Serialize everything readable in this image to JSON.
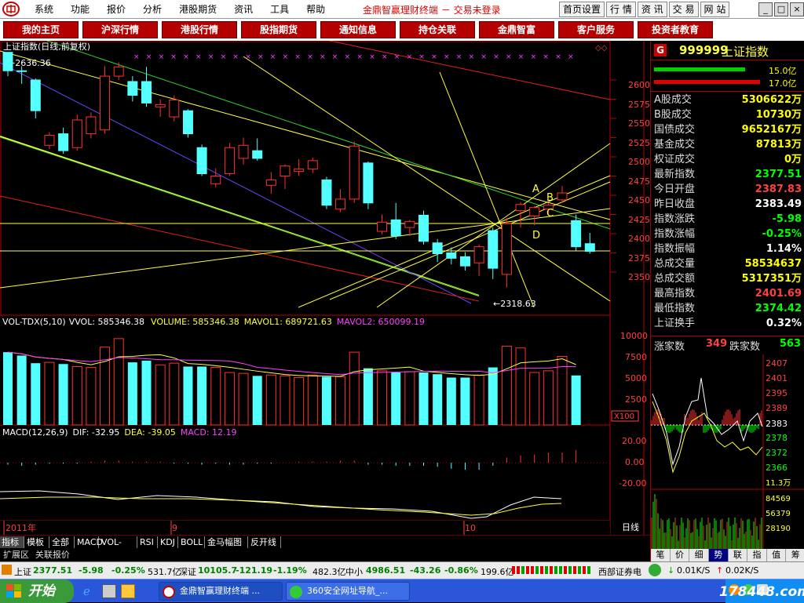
{
  "menubar": {
    "items": [
      "系统",
      "功能",
      "报价",
      "分析",
      "港股期货",
      "资讯",
      "工具",
      "帮助"
    ],
    "app_title": "金鼎智赢理财终端 － 交易未登录",
    "tool_buttons": [
      "首页设置",
      "行 情",
      "资 讯",
      "交 易",
      "网 站"
    ],
    "win_buttons": [
      "_",
      "□",
      "×"
    ]
  },
  "nav_tabs": [
    "我的主页",
    "沪深行情",
    "港股行情",
    "股指期货",
    "通知信息",
    "持仓关联",
    "金鼎智富",
    "客户服务",
    "投资者教育"
  ],
  "chart": {
    "title": "上证指数(日线,前复权)",
    "high_mark": "2636.36",
    "low_mark": "2318.63",
    "price_axis": [
      "2600",
      "2575",
      "2550",
      "2525",
      "2500",
      "2475",
      "2450",
      "2425",
      "2400",
      "2375",
      "2350"
    ],
    "wave_labels": [
      "A",
      "B",
      "C",
      "D"
    ],
    "volume_header": {
      "name": "VOL-TDX(5,10)",
      "vvol": "VVOL: 585346.38",
      "volume": "VOLUME: 585346.38",
      "mavol1": "MAVOL1: 689721.63",
      "mavol2": "MAVOL2: 650099.19"
    },
    "volume_axis": [
      "10000",
      "7500",
      "5000",
      "2500"
    ],
    "volume_unit": "X100",
    "macd_header": {
      "name": "MACD(12,26,9)",
      "dif": "DIF: -32.95",
      "dea": "DEA: -39.05",
      "macd": "MACD: 12.19"
    },
    "macd_axis": [
      "20.00",
      "0.00",
      "-20.00"
    ],
    "date_labels": [
      "2011年",
      "9",
      "10"
    ],
    "period_label": "日线",
    "zoom_buttons": [
      "+",
      "-",
      "○"
    ],
    "colors": {
      "up": "#ff3030",
      "down": "#54ffff",
      "ma1": "#ffff60",
      "ma2": "#ff40ff",
      "axis": "#b40000"
    }
  },
  "chart_data": {
    "type": "candlestick",
    "title": "上证指数(日线,前复权)",
    "ylim": [
      2318.63,
      2636.36
    ],
    "candles": [
      {
        "o": 2636,
        "c": 2612,
        "h": 2636,
        "l": 2605
      },
      {
        "o": 2612,
        "c": 2611,
        "h": 2618,
        "l": 2595
      },
      {
        "o": 2600,
        "c": 2560,
        "h": 2602,
        "l": 2550
      },
      {
        "o": 2515,
        "c": 2528,
        "h": 2532,
        "l": 2510
      },
      {
        "o": 2530,
        "c": 2508,
        "h": 2538,
        "l": 2504
      },
      {
        "o": 2512,
        "c": 2548,
        "h": 2555,
        "l": 2508
      },
      {
        "o": 2530,
        "c": 2552,
        "h": 2558,
        "l": 2524
      },
      {
        "o": 2535,
        "c": 2605,
        "h": 2618,
        "l": 2530
      },
      {
        "o": 2605,
        "c": 2617,
        "h": 2623,
        "l": 2600
      },
      {
        "o": 2598,
        "c": 2580,
        "h": 2605,
        "l": 2572
      },
      {
        "o": 2598,
        "c": 2570,
        "h": 2617,
        "l": 2565
      },
      {
        "o": 2565,
        "c": 2568,
        "h": 2575,
        "l": 2552
      },
      {
        "o": 2552,
        "c": 2574,
        "h": 2580,
        "l": 2546
      },
      {
        "o": 2560,
        "c": 2530,
        "h": 2562,
        "l": 2525
      },
      {
        "o": 2512,
        "c": 2478,
        "h": 2516,
        "l": 2475
      },
      {
        "o": 2465,
        "c": 2475,
        "h": 2485,
        "l": 2460
      },
      {
        "o": 2478,
        "c": 2512,
        "h": 2518,
        "l": 2475
      },
      {
        "o": 2498,
        "c": 2515,
        "h": 2525,
        "l": 2490
      },
      {
        "o": 2508,
        "c": 2498,
        "h": 2524,
        "l": 2495
      },
      {
        "o": 2463,
        "c": 2470,
        "h": 2480,
        "l": 2452
      },
      {
        "o": 2475,
        "c": 2488,
        "h": 2490,
        "l": 2458
      },
      {
        "o": 2481,
        "c": 2484,
        "h": 2497,
        "l": 2475
      },
      {
        "o": 2484,
        "c": 2495,
        "h": 2499,
        "l": 2479
      },
      {
        "o": 2470,
        "c": 2437,
        "h": 2474,
        "l": 2432
      },
      {
        "o": 2432,
        "c": 2445,
        "h": 2458,
        "l": 2428
      },
      {
        "o": 2445,
        "c": 2514,
        "h": 2520,
        "l": 2440
      },
      {
        "o": 2492,
        "c": 2440,
        "h": 2494,
        "l": 2432
      },
      {
        "o": 2403,
        "c": 2415,
        "h": 2425,
        "l": 2399
      },
      {
        "o": 2418,
        "c": 2397,
        "h": 2440,
        "l": 2393
      },
      {
        "o": 2408,
        "c": 2416,
        "h": 2418,
        "l": 2397
      },
      {
        "o": 2424,
        "c": 2390,
        "h": 2430,
        "l": 2386
      },
      {
        "o": 2388,
        "c": 2374,
        "h": 2393,
        "l": 2363
      },
      {
        "o": 2375,
        "c": 2368,
        "h": 2382,
        "l": 2360
      },
      {
        "o": 2370,
        "c": 2358,
        "h": 2376,
        "l": 2352
      },
      {
        "o": 2362,
        "c": 2383,
        "h": 2386,
        "l": 2345
      },
      {
        "o": 2404,
        "c": 2355,
        "h": 2408,
        "l": 2341
      },
      {
        "o": 2347,
        "c": 2413,
        "h": 2420,
        "l": 2330
      },
      {
        "o": 2430,
        "c": 2438,
        "h": 2441,
        "l": 2408
      },
      {
        "o": 2423,
        "c": 2434,
        "h": 2436,
        "l": 2411
      },
      {
        "o": 2432,
        "c": 2437,
        "h": 2440,
        "l": 2425
      },
      {
        "o": 2444,
        "c": 2453,
        "h": 2462,
        "l": 2440
      },
      {
        "o": 2417,
        "c": 2383,
        "h": 2425,
        "l": 2378
      },
      {
        "o": 2387,
        "c": 2377,
        "h": 2401,
        "l": 2374
      }
    ],
    "volume": [
      8600,
      8200,
      7300,
      7400,
      7200,
      6900,
      6800,
      9200,
      10200,
      7400,
      7600,
      7100,
      7300,
      6900,
      6900,
      6800,
      6200,
      6100,
      5800,
      5900,
      5800,
      5600,
      5900,
      5700,
      5700,
      8600,
      6700,
      6400,
      6200,
      6300,
      6200,
      6000,
      5600,
      5600,
      5900,
      6800,
      9300,
      9100,
      6200,
      6400,
      8100,
      5853
    ],
    "macd": [
      -2,
      -3,
      -2,
      -1,
      -1,
      -1,
      1,
      2,
      2,
      1,
      1,
      1,
      -1,
      -1,
      -2,
      -1,
      -2,
      -2,
      -1,
      -1,
      0,
      1,
      1,
      1,
      2,
      2,
      -2,
      -2,
      -3,
      -3,
      -3,
      -4,
      -6,
      -7,
      -7,
      -3,
      5,
      7,
      8,
      10,
      10,
      12.19
    ],
    "volume_ma": {
      "mavol1": 689721.63,
      "mavol2": 650099.19
    },
    "macd_values": {
      "dif": -32.95,
      "dea": -39.05,
      "macd": 12.19
    }
  },
  "panel": {
    "badge": "G",
    "code": "999999",
    "name": "上证指数",
    "bar1": "15.0亿",
    "bar2": "17.0亿",
    "rows": [
      {
        "label": "A股成交",
        "value": "5306622万",
        "color": "#ffff00"
      },
      {
        "label": "B股成交",
        "value": "10730万",
        "color": "#ffff00"
      },
      {
        "label": "国债成交",
        "value": "9652167万",
        "color": "#ffff00"
      },
      {
        "label": "基金成交",
        "value": "87813万",
        "color": "#ffff00"
      },
      {
        "label": "权证成交",
        "value": "0万",
        "color": "#ffff00"
      },
      {
        "label": "最新指数",
        "value": "2377.51",
        "color": "#00ff00"
      },
      {
        "label": "今日开盘",
        "value": "2387.83",
        "color": "#ff4040"
      },
      {
        "label": "昨日收盘",
        "value": "2383.49",
        "color": "#ffffff"
      },
      {
        "label": "指数涨跌",
        "value": "-5.98",
        "color": "#00ff00"
      },
      {
        "label": "指数涨幅",
        "value": "-0.25%",
        "color": "#00ff00"
      },
      {
        "label": "指数振幅",
        "value": "1.14%",
        "color": "#ffffff"
      },
      {
        "label": "总成交量",
        "value": "58534637",
        "color": "#ffff00"
      },
      {
        "label": "总成交额",
        "value": "5317351万",
        "color": "#ffff00"
      },
      {
        "label": "最高指数",
        "value": "2401.69",
        "color": "#ff4040"
      },
      {
        "label": "最低指数",
        "value": "2374.42",
        "color": "#00ff00"
      },
      {
        "label": "上证换手",
        "value": "0.32%",
        "color": "#ffffff"
      }
    ],
    "rise_label": "涨家数",
    "rise_value": "349",
    "fall_label": "跌家数",
    "fall_value": "563",
    "mini_axis": [
      "2407",
      "2401",
      "2395",
      "2389",
      "2383",
      "2378",
      "2372",
      "2366"
    ],
    "mini_volume_axis": [
      "11.3万",
      "84569",
      "56379",
      "28190"
    ],
    "bottom_tabs": [
      "笔",
      "价",
      "细",
      "势",
      "联",
      "指",
      "值",
      "筹"
    ]
  },
  "bottom_tabs": [
    "指标",
    "模板",
    "全部",
    "MACD",
    "VOL-TDX",
    "RSI",
    "KDJ",
    "BOLL",
    "金马幅图",
    "反开线"
  ],
  "ext_tabs": [
    "扩展区",
    "关联报价"
  ],
  "ticker": {
    "sh_label": "上证",
    "sh_price": "2377.51",
    "sh_change": "-5.98",
    "sh_pct": "-0.25%",
    "sh_amount": "531.7亿",
    "sz_label": "深证",
    "sz_price": "10105.7",
    "sz_change": "-121.19",
    "sz_pct": "-1.19%",
    "sz_amount": "482.3亿",
    "zx_label": "中小",
    "zx_price": "4986.51",
    "zx_change": "-43.26",
    "zx_pct": "-0.86%",
    "zx_amount": "199.6亿",
    "broker": "西部证券电",
    "down_speed": "0.01K/S",
    "up_speed": "0.02K/S"
  },
  "taskbar": {
    "start": "开始",
    "win1": "金鼎智赢理财终端 ...",
    "win2": "360安全网址导航_...",
    "watermark": "178448.com"
  }
}
